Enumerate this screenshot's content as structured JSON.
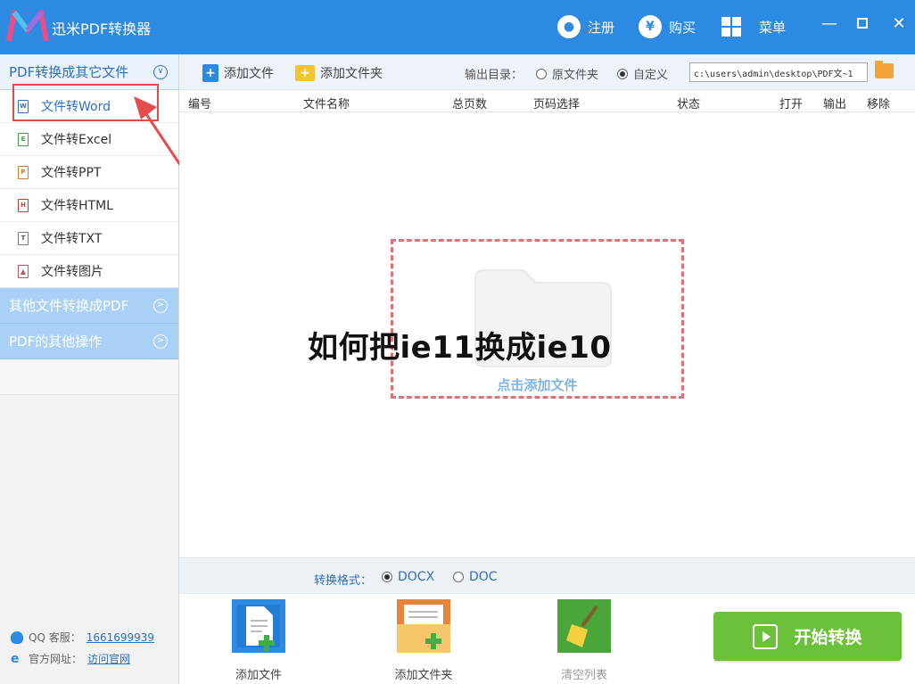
{
  "window": {
    "title": "迅米PDF转换器",
    "register_label": "注册",
    "buy_label": "购买",
    "menu_label": "菜单"
  },
  "sidebar": {
    "section_active": "PDF转换成其它文件",
    "items": [
      {
        "label": "文件转Word",
        "icon": "W"
      },
      {
        "label": "文件转Excel",
        "icon": "E"
      },
      {
        "label": "文件转PPT",
        "icon": "P"
      },
      {
        "label": "文件转HTML",
        "icon": "H"
      },
      {
        "label": "文件转TXT",
        "icon": "T"
      },
      {
        "label": "文件转图片",
        "icon": "img"
      }
    ],
    "section_2": "其他文件转换成PDF",
    "section_3": "PDF的其他操作",
    "qq_label": "QQ 客服：",
    "qq_number": "1661699939",
    "site_label": "官方网址：",
    "site_link": "访问官网"
  },
  "toolbar": {
    "add_file": "添加文件",
    "add_folder": "添加文件夹",
    "output_label": "输出目录：",
    "opt_original": "原文件夹",
    "opt_custom": "自定义",
    "selected_option": "自定义",
    "output_path": "c:\\users\\admin\\desktop\\PDF文~1"
  },
  "table": {
    "columns": [
      "编号",
      "文件名称",
      "总页数",
      "页码选择",
      "状态",
      "打开",
      "输出",
      "移除"
    ]
  },
  "dropzone": {
    "text": "点击添加文件"
  },
  "overlay_title": "如何把ie11换成ie10",
  "format": {
    "label": "转换格式：",
    "options": [
      "DOCX",
      "DOC"
    ],
    "selected": "DOCX"
  },
  "bottom": {
    "add_file": "添加文件",
    "add_folder": "添加文件夹",
    "clear_list": "清空列表",
    "start": "开始转换"
  },
  "colors": {
    "brand_blue": "#2d8ae3",
    "start_green": "#6bc23a",
    "highlight_red": "#e74b4b"
  }
}
